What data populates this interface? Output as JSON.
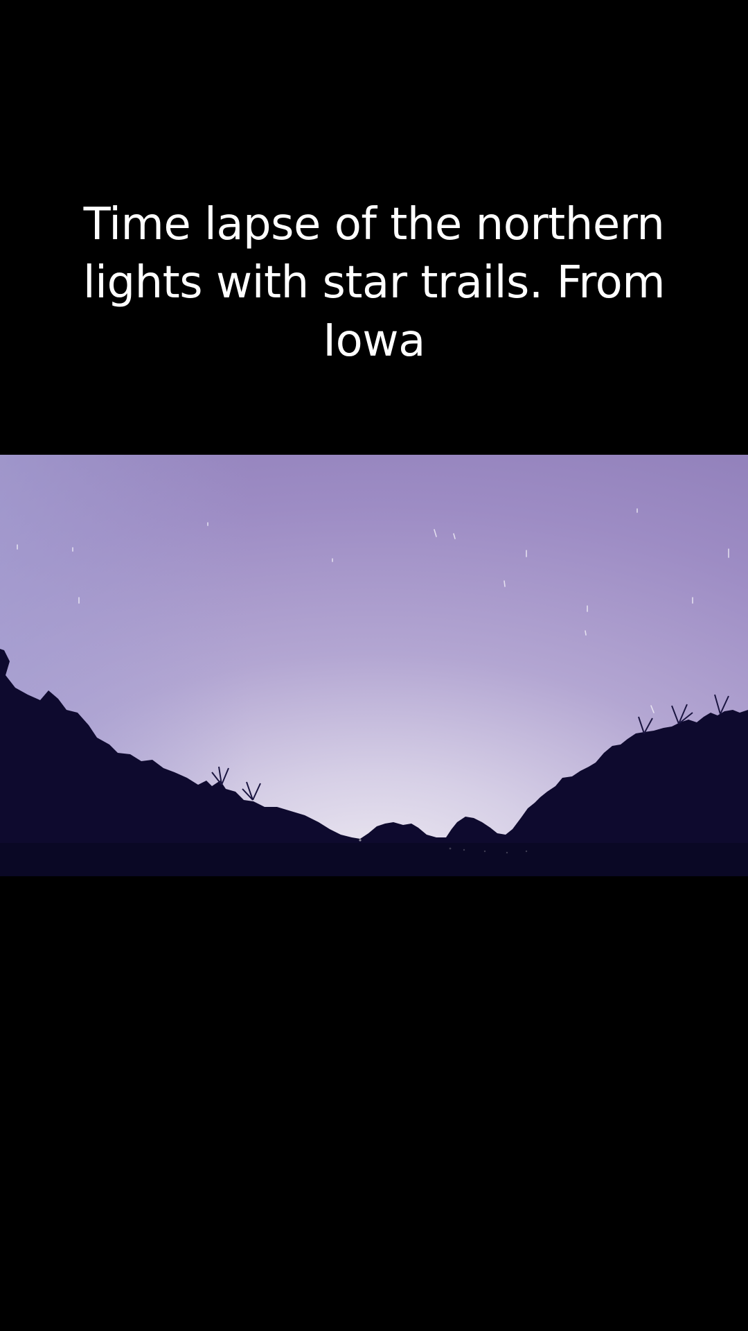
{
  "caption": {
    "lines": [
      "Time lapse of the northern",
      "lights with star trails. From",
      "Iowa"
    ]
  },
  "video": {
    "colors": {
      "sky_top": "#9585c0",
      "sky_mid": "#b3a6d2",
      "sky_horizon": "#d9d3e6",
      "trees": "#0e0a2e"
    }
  }
}
